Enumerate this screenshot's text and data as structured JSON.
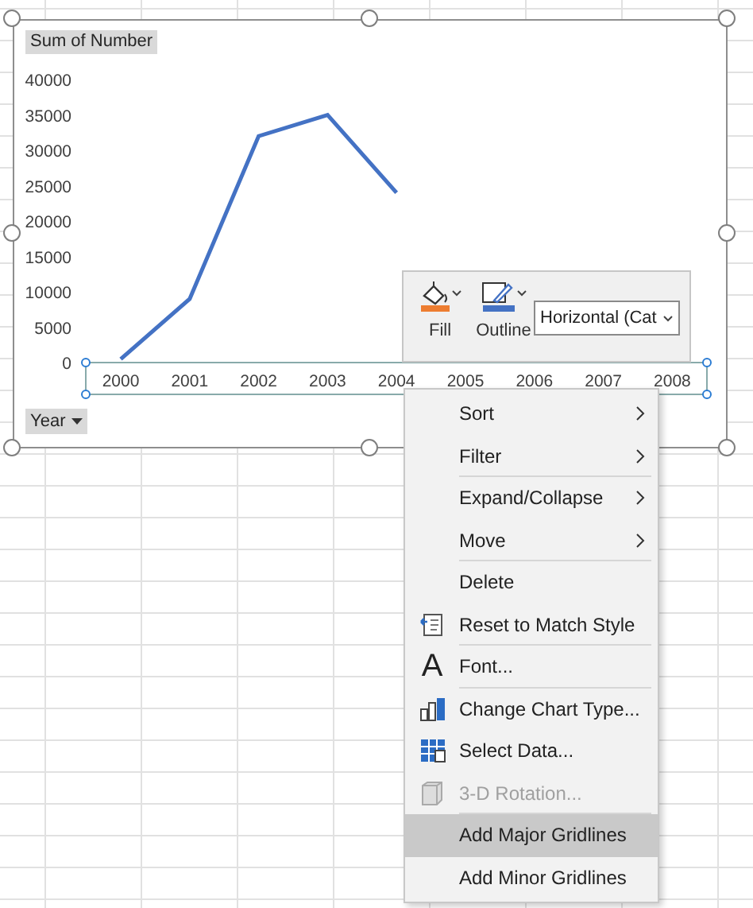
{
  "chart": {
    "value_field_button": "Sum of Number",
    "axis_field_button": "Year",
    "axis_selected": true,
    "chart_data": {
      "type": "line",
      "categories": [
        "2000",
        "2001",
        "2002",
        "2003",
        "2004",
        "2005",
        "2006",
        "2007",
        "2008"
      ],
      "series": [
        {
          "color": "#4472c4",
          "values": [
            500,
            9000,
            32000,
            35000,
            24000,
            null,
            null,
            null,
            null
          ]
        }
      ],
      "ylim": [
        0,
        40000
      ],
      "yticks": [
        0,
        5000,
        10000,
        15000,
        20000,
        25000,
        30000,
        35000,
        40000
      ]
    }
  },
  "format_toolbar": {
    "fill": {
      "label": "Fill",
      "color": "#ed7d31"
    },
    "outline": {
      "label": "Outline",
      "color": "#4472c4"
    },
    "element_dropdown": "Horizontal (Cat"
  },
  "context_menu": [
    {
      "label": "Sort",
      "kind": "plain",
      "submenu": true,
      "disabled": false,
      "selected": false,
      "separator_after": false
    },
    {
      "label": "Filter",
      "kind": "plain",
      "submenu": true,
      "disabled": false,
      "selected": false,
      "separator_after": true
    },
    {
      "label": "Expand/Collapse",
      "kind": "plain",
      "submenu": true,
      "disabled": false,
      "selected": false,
      "separator_after": false
    },
    {
      "label": "Move",
      "kind": "plain",
      "submenu": true,
      "disabled": false,
      "selected": false,
      "separator_after": true
    },
    {
      "label": "Delete",
      "kind": "plain",
      "submenu": false,
      "disabled": false,
      "selected": false,
      "separator_after": false
    },
    {
      "label": "Reset to Match Style",
      "kind": "reset",
      "submenu": false,
      "disabled": false,
      "selected": false,
      "separator_after": true
    },
    {
      "label": "Font...",
      "kind": "font",
      "icon_text": "A",
      "submenu": false,
      "disabled": false,
      "selected": false,
      "separator_after": true
    },
    {
      "label": "Change Chart Type...",
      "kind": "chart-type",
      "submenu": false,
      "disabled": false,
      "selected": false,
      "separator_after": false
    },
    {
      "label": "Select Data...",
      "kind": "select-data",
      "submenu": false,
      "disabled": false,
      "selected": false,
      "separator_after": false
    },
    {
      "label": "3-D Rotation...",
      "kind": "rotation",
      "submenu": false,
      "disabled": true,
      "selected": false,
      "separator_after": true
    },
    {
      "label": "Add Major Gridlines",
      "kind": "plain",
      "submenu": false,
      "disabled": false,
      "selected": true,
      "separator_after": false
    },
    {
      "label": "Add Minor Gridlines",
      "kind": "plain",
      "submenu": false,
      "disabled": false,
      "selected": false,
      "separator_after": false
    }
  ]
}
